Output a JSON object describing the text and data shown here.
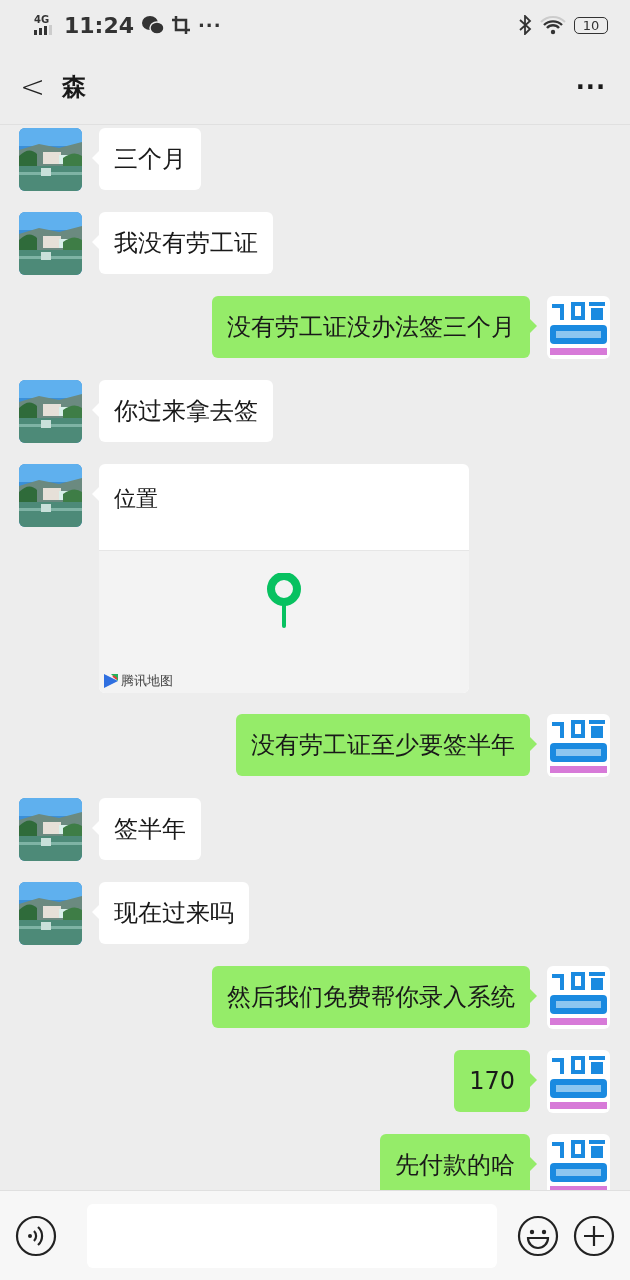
{
  "status_bar": {
    "network": "4G",
    "time": "11:24",
    "more": "···",
    "battery": "10"
  },
  "header": {
    "back": "<",
    "title": "森",
    "more": "···"
  },
  "messages": [
    {
      "outgoing": false,
      "kind": "text",
      "text": "三个月"
    },
    {
      "outgoing": false,
      "kind": "text",
      "text": "我没有劳工证"
    },
    {
      "outgoing": true,
      "kind": "text",
      "text": "没有劳工证没办法签三个月"
    },
    {
      "outgoing": false,
      "kind": "text",
      "text": "你过来拿去签"
    },
    {
      "outgoing": false,
      "kind": "location",
      "text": "位置",
      "attribution": "腾讯地图"
    },
    {
      "outgoing": true,
      "kind": "text",
      "text": "没有劳工证至少要签半年"
    },
    {
      "outgoing": false,
      "kind": "text",
      "text": "签半年"
    },
    {
      "outgoing": false,
      "kind": "text",
      "text": "现在过来吗"
    },
    {
      "outgoing": true,
      "kind": "text",
      "text": "然后我们免费帮你录入系统"
    },
    {
      "outgoing": true,
      "kind": "text",
      "text": "170"
    },
    {
      "outgoing": true,
      "kind": "text",
      "text": "先付款的哈"
    }
  ]
}
